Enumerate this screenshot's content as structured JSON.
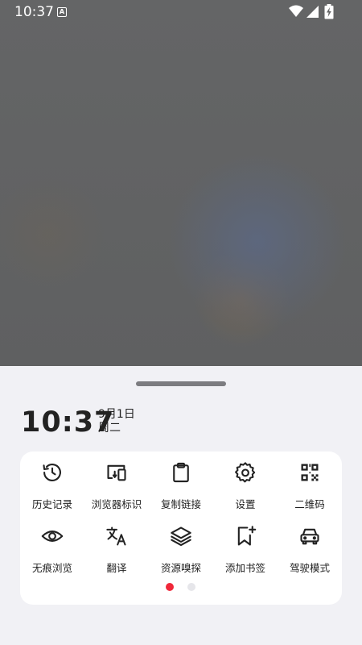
{
  "status_bar": {
    "time": "10:37",
    "badge": "A"
  },
  "clock": {
    "time": "10:37",
    "date": "9月1日",
    "weekday": "周二"
  },
  "menu": {
    "items": [
      {
        "label": "历史记录",
        "icon": "history-icon"
      },
      {
        "label": "浏览器标识",
        "icon": "devices-icon"
      },
      {
        "label": "复制链接",
        "icon": "clipboard-icon"
      },
      {
        "label": "设置",
        "icon": "gear-icon"
      },
      {
        "label": "二维码",
        "icon": "qr-code-icon"
      },
      {
        "label": "无痕浏览",
        "icon": "eye-icon"
      },
      {
        "label": "翻译",
        "icon": "translate-icon"
      },
      {
        "label": "资源嗅探",
        "icon": "layers-icon"
      },
      {
        "label": "添加书签",
        "icon": "bookmark-add-icon"
      },
      {
        "label": "驾驶模式",
        "icon": "car-icon"
      }
    ]
  },
  "pagination": {
    "pages": 2,
    "current": 1
  },
  "colors": {
    "accent": "#f0283a",
    "panel": "#ffffff",
    "sheet": "#f1f1f5"
  }
}
